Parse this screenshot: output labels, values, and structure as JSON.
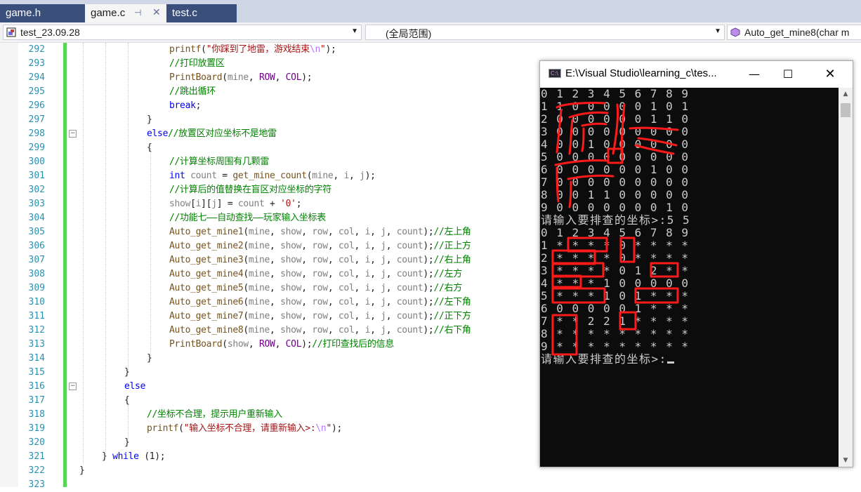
{
  "tabs": [
    {
      "label": "game.h",
      "active": false
    },
    {
      "label": "game.c",
      "active": true
    },
    {
      "label": "test.c",
      "active": false
    }
  ],
  "navbar": {
    "project": "test_23.09.28",
    "scope": "(全局范围)",
    "member": "Auto_get_mine8(char m"
  },
  "editor": {
    "lines": [
      {
        "n": "292",
        "html": "<span class=\"fn\">printf</span>(<span class=\"st\">\"你踩到了地雷，游戏结束<span class=\"esc\">\\n</span>\"</span>);",
        "indent": 16
      },
      {
        "n": "293",
        "html": "<span class=\"cm\">//打印放置区</span>",
        "indent": 16
      },
      {
        "n": "294",
        "html": "<span class=\"fn\">PrintBoard</span>(<span class=\"par\">mine</span>, <span class=\"mac\">ROW</span>, <span class=\"mac\">COL</span>);",
        "indent": 16
      },
      {
        "n": "295",
        "html": "<span class=\"cm\">//跳出循环</span>",
        "indent": 16
      },
      {
        "n": "296",
        "html": "<span class=\"kw\">break</span>;",
        "indent": 16
      },
      {
        "n": "297",
        "html": "}",
        "indent": 12
      },
      {
        "n": "298",
        "html": "<span class=\"kw\">else</span><span class=\"cm\">//放置区对应坐标不是地雷</span>",
        "indent": 12
      },
      {
        "n": "299",
        "html": "{",
        "indent": 12
      },
      {
        "n": "300",
        "html": "<span class=\"cm\">//计算坐标周围有几颗雷</span>",
        "indent": 16
      },
      {
        "n": "301",
        "html": "<span class=\"kw\">int</span> <span class=\"par\">count</span> = <span class=\"fn\">get_mine_count</span>(<span class=\"par\">mine</span>, <span class=\"par\">i</span>, <span class=\"par\">j</span>);",
        "indent": 16
      },
      {
        "n": "302",
        "html": "<span class=\"cm\">//计算后的值替换在盲区对应坐标的字符</span>",
        "indent": 16
      },
      {
        "n": "303",
        "html": "<span class=\"par\">show</span>[<span class=\"par\">i</span>][<span class=\"par\">j</span>] = <span class=\"par\">count</span> + <span class=\"st\">'0'</span>;",
        "indent": 16
      },
      {
        "n": "304",
        "html": "<span class=\"cm\">//功能七——自动查找——玩家输入坐标表</span>",
        "indent": 16
      },
      {
        "n": "305",
        "html": "<span class=\"fn\">Auto_get_mine1</span>(<span class=\"par\">mine</span>, <span class=\"par\">show</span>, <span class=\"par\">row</span>, <span class=\"par\">col</span>, <span class=\"par\">i</span>, <span class=\"par\">j</span>, <span class=\"par\">count</span>);<span class=\"cm\">//左上角</span>",
        "indent": 16
      },
      {
        "n": "306",
        "html": "<span class=\"fn\">Auto_get_mine2</span>(<span class=\"par\">mine</span>, <span class=\"par\">show</span>, <span class=\"par\">row</span>, <span class=\"par\">col</span>, <span class=\"par\">i</span>, <span class=\"par\">j</span>, <span class=\"par\">count</span>);<span class=\"cm\">//正上方</span>",
        "indent": 16
      },
      {
        "n": "307",
        "html": "<span class=\"fn\">Auto_get_mine3</span>(<span class=\"par\">mine</span>, <span class=\"par\">show</span>, <span class=\"par\">row</span>, <span class=\"par\">col</span>, <span class=\"par\">i</span>, <span class=\"par\">j</span>, <span class=\"par\">count</span>);<span class=\"cm\">//右上角</span>",
        "indent": 16
      },
      {
        "n": "308",
        "html": "<span class=\"fn\">Auto_get_mine4</span>(<span class=\"par\">mine</span>, <span class=\"par\">show</span>, <span class=\"par\">row</span>, <span class=\"par\">col</span>, <span class=\"par\">i</span>, <span class=\"par\">j</span>, <span class=\"par\">count</span>);<span class=\"cm\">//左方</span>",
        "indent": 16
      },
      {
        "n": "309",
        "html": "<span class=\"fn\">Auto_get_mine5</span>(<span class=\"par\">mine</span>, <span class=\"par\">show</span>, <span class=\"par\">row</span>, <span class=\"par\">col</span>, <span class=\"par\">i</span>, <span class=\"par\">j</span>, <span class=\"par\">count</span>);<span class=\"cm\">//右方</span>",
        "indent": 16
      },
      {
        "n": "310",
        "html": "<span class=\"fn\">Auto_get_mine6</span>(<span class=\"par\">mine</span>, <span class=\"par\">show</span>, <span class=\"par\">row</span>, <span class=\"par\">col</span>, <span class=\"par\">i</span>, <span class=\"par\">j</span>, <span class=\"par\">count</span>);<span class=\"cm\">//左下角</span>",
        "indent": 16
      },
      {
        "n": "311",
        "html": "<span class=\"fn\">Auto_get_mine7</span>(<span class=\"par\">mine</span>, <span class=\"par\">show</span>, <span class=\"par\">row</span>, <span class=\"par\">col</span>, <span class=\"par\">i</span>, <span class=\"par\">j</span>, <span class=\"par\">count</span>);<span class=\"cm\">//正下方</span>",
        "indent": 16
      },
      {
        "n": "312",
        "html": "<span class=\"fn\">Auto_get_mine8</span>(<span class=\"par\">mine</span>, <span class=\"par\">show</span>, <span class=\"par\">row</span>, <span class=\"par\">col</span>, <span class=\"par\">i</span>, <span class=\"par\">j</span>, <span class=\"par\">count</span>);<span class=\"cm\">//右下角</span>",
        "indent": 16
      },
      {
        "n": "313",
        "html": "<span class=\"fn\">PrintBoard</span>(<span class=\"par\">show</span>, <span class=\"mac\">ROW</span>, <span class=\"mac\">COL</span>);<span class=\"cm\">//打印查找后的信息</span>",
        "indent": 16
      },
      {
        "n": "314",
        "html": "}",
        "indent": 12
      },
      {
        "n": "315",
        "html": "}",
        "indent": 8
      },
      {
        "n": "316",
        "html": "<span class=\"kw\">else</span>",
        "indent": 8
      },
      {
        "n": "317",
        "html": "{",
        "indent": 8
      },
      {
        "n": "318",
        "html": "<span class=\"cm\">//坐标不合理，提示用户重新输入</span>",
        "indent": 12
      },
      {
        "n": "319",
        "html": "<span class=\"fn\">printf</span>(<span class=\"st\">\"输入坐标不合理，请重新输入&gt;:<span class=\"esc\">\\n</span>\"</span>);",
        "indent": 12
      },
      {
        "n": "320",
        "html": "}",
        "indent": 8
      },
      {
        "n": "321",
        "html": "} <span class=\"kw\">while</span> (1);",
        "indent": 4
      },
      {
        "n": "322",
        "html": "}",
        "indent": 0
      },
      {
        "n": "323",
        "html": "",
        "indent": 0
      }
    ]
  },
  "console": {
    "title": "E:\\Visual Studio\\learning_c\\tes...",
    "lines": [
      "0 1 2 3 4 5 6 7 8 9",
      "1 1 0 0 0 0 0 1 0 1",
      "2 0 0 0 0 0 0 1 1 0",
      "3 0 0 0 0 0 0 0 0 0",
      "4 0 0 1 0 0 0 0 0 0",
      "5 0 0 0 0 0 0 0 0 0",
      "6 0 0 0 0 0 0 1 0 0",
      "7 0 0 0 0 0 0 0 0 0",
      "8 0 0 1 1 0 0 0 0 0",
      "9 0 0 0 0 0 0 0 1 0",
      "请输入要排查的坐标>:5 5",
      "0 1 2 3 4 5 6 7 8 9",
      "1 * * * * 0 * * * *",
      "2 * * * * 0 * * * *",
      "3 * * * * 0 1 2 * *",
      "4 * * * 1 0 0 0 0 0",
      "5 * * * 1 0 1 * * *",
      "6 0 0 0 0 0 1 * * *",
      "7 * * 2 2 1 * * * *",
      "8 * * * * * * * * *",
      "9 * * * * * * * * *",
      "请输入要排查的坐标>:"
    ]
  },
  "colors": {
    "annotation": "#ff1a1a",
    "change_bar": "#57d657",
    "console_bg": "#0c0c0c",
    "console_fg": "#cccccc"
  }
}
